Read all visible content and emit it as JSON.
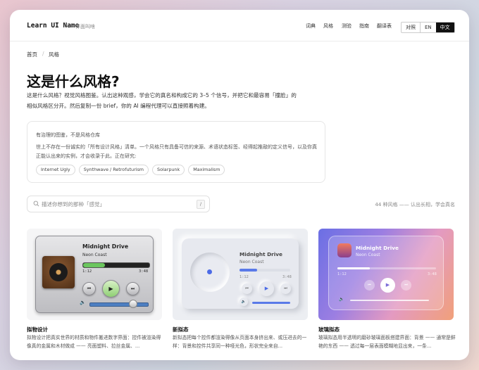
{
  "header": {
    "brand": "Learn UI Name",
    "brand_sub": "界面叫啥",
    "nav": [
      "词典",
      "风格",
      "测验",
      "指南",
      "翻译表"
    ],
    "lang": [
      "对照",
      "EN",
      "中文"
    ]
  },
  "breadcrumb": {
    "home": "首页",
    "sep": "/",
    "current": "风格"
  },
  "page": {
    "title": "这是什么风格?",
    "intro": "这是什么风格？视觉风格图鉴。认出这种观感，学会它的真名和构成它的 3–5 个信号，并把它和最容易「撞脸」的相似风格区分开。然后复制一份 brief，你的 AI 编程代理可以直接照着构建。"
  },
  "infobox": {
    "title": "有治理的图鉴，不是风格仓库",
    "text": "世上不存在一份诚实的「所有设计风格」清单。一个风格只有具备可信的来源、术语状态标签、经得起推敲的定义信号，以及你真正能认出来的实例，才会收录于此。正在研究:",
    "chips": [
      "Internet Ugly",
      "Synthwave / Retrofuturism",
      "Solarpunk",
      "Maximalism"
    ]
  },
  "search": {
    "placeholder": "描述你想到的那种「感觉」",
    "shortcut": "/"
  },
  "count": "44 种风格 —— 认出长相，学会真名",
  "cards": [
    {
      "title": "拟物设计",
      "desc": "拟物设计把真实世界的材质和物件搬进数字界面：控件被渲染得像真的金属和木材做成 —— 亮面塑料、拉丝金属、...",
      "player": {
        "title": "Midnight Drive",
        "artist": "Neon Coast",
        "t0": "1:12",
        "t1": "3:48",
        "progress": 0.33,
        "volume": 0.72
      }
    },
    {
      "title": "新拟态",
      "desc": "新拟态把每个控件都渲染得像从页面本身挤出来、或压进去的一样：背景和控件共享同一种哑光色，形状完全来自...",
      "player": {
        "title": "Midnight Drive",
        "artist": "Neon Coast",
        "t0": "1:12",
        "t1": "3:48",
        "progress": 0.35,
        "volume": 1.0
      }
    },
    {
      "title": "玻璃拟态",
      "desc": "玻璃拟态用半透明的磨砂玻璃面板搭建界面：背景 —— 通常是鲜艳的东西 —— 透过每一层表面模糊地显出来，一条...",
      "player": {
        "title": "Midnight Drive",
        "artist": "Neon Coast",
        "t0": "1:12",
        "t1": "3:48",
        "progress": 0.33,
        "volume": 0.62
      }
    }
  ]
}
